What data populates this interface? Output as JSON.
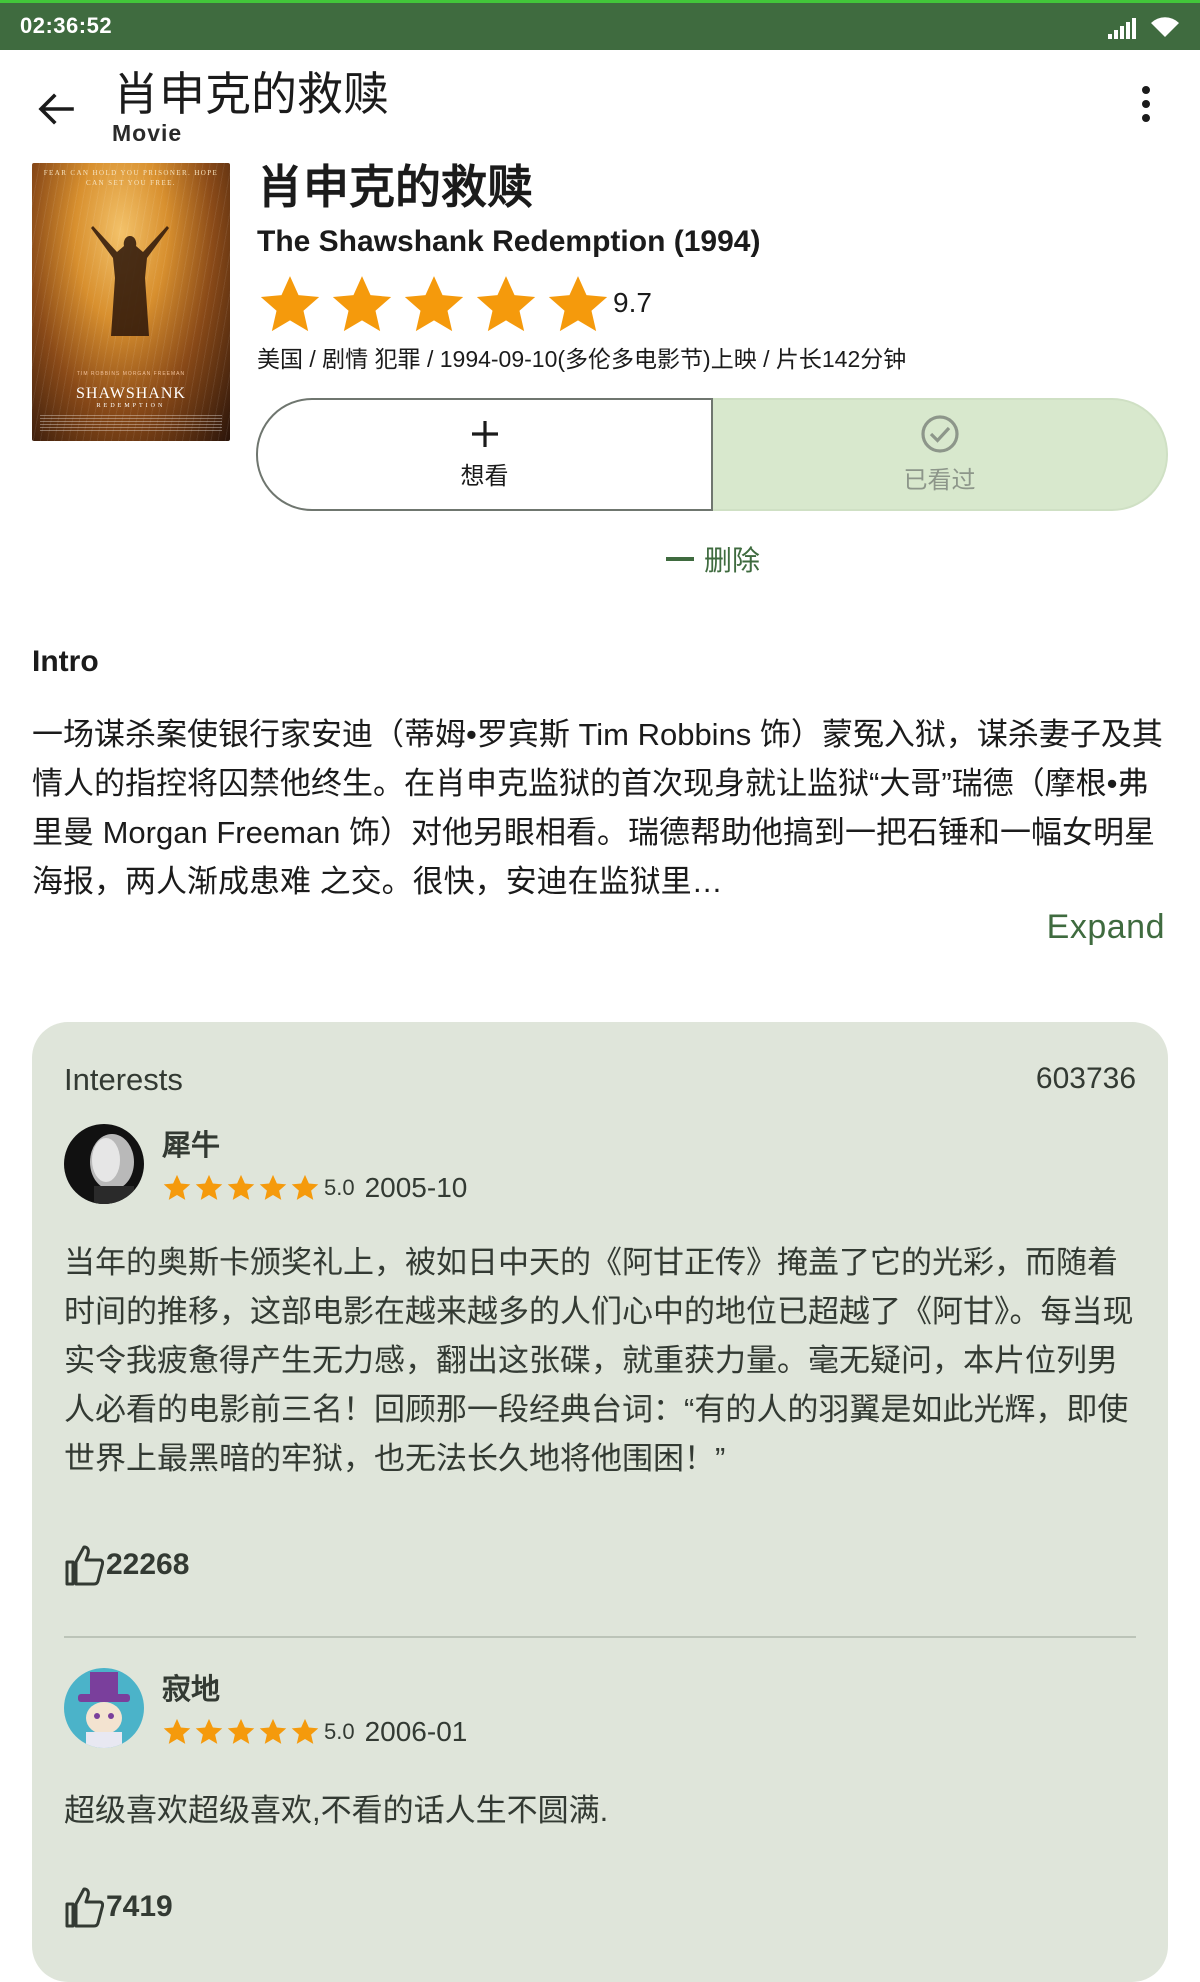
{
  "status_bar": {
    "time": "02:36:52"
  },
  "app_bar": {
    "title": "肖申克的救赎",
    "subtitle": "Movie"
  },
  "poster": {
    "tagline": "FEAR CAN HOLD YOU PRISONER. HOPE CAN SET YOU FREE.",
    "credits_top": "TIM ROBBINS   MORGAN FREEMAN",
    "title": "SHAWSHANK",
    "subtitle": "REDEMPTION"
  },
  "movie": {
    "title_cn": "肖申克的救赎",
    "title_en": "The Shawshank Redemption (1994)",
    "rating": "9.7",
    "stars": 5,
    "meta": "美国 / 剧情 犯罪 / 1994-09-10(多伦多电影节)上映 / 片长142分钟"
  },
  "actions": {
    "want": "想看",
    "watched": "已看过",
    "delete": "删除"
  },
  "intro": {
    "heading": "Intro",
    "text": "一场谋杀案使银行家安迪（蒂姆•罗宾斯 Tim Robbins 饰）蒙冤入狱，谋杀妻子及其情人的指控将囚禁他终生。在肖申克监狱的首次现身就让监狱“大哥”瑞德（摩根•弗里曼 Morgan Freeman 饰）对他另眼相看。瑞德帮助他搞到一把石锤和一幅女明星海报，两人渐成患难 之交。很快，安迪在监狱里…",
    "expand": "Expand"
  },
  "interests": {
    "title": "Interests",
    "count": "603736",
    "reviews": [
      {
        "name": "犀牛",
        "score": "5.0",
        "date": "2005-10",
        "text": "当年的奥斯卡颁奖礼上，被如日中天的《阿甘正传》掩盖了它的光彩，而随着时间的推移，这部电影在越来越多的人们心中的地位已超越了《阿甘》。每当现实令我疲惫得产生无力感，翻出这张碟，就重获力量。毫无疑问，本片位列男人必看的电影前三名！回顾那一段经典台词：“有的人的羽翼是如此光辉，即使世界上最黑暗的牢狱，也无法长久地将他围困！”",
        "likes": "22268"
      },
      {
        "name": "寂地",
        "score": "5.0",
        "date": "2006-01",
        "text": "超级喜欢超级喜欢,不看的话人生不圆满.",
        "likes": "7419"
      }
    ]
  },
  "colors": {
    "primary": "#3f6b3f",
    "star": "#f59a0c",
    "card_bg": "#dfe5da",
    "watched_bg": "#d8e8cd"
  },
  "icons": [
    "arrow-back-icon",
    "more-vert-icon",
    "star-icon",
    "plus-icon",
    "check-circle-icon",
    "thumb-up-icon",
    "signal-icon",
    "wifi-icon"
  ]
}
